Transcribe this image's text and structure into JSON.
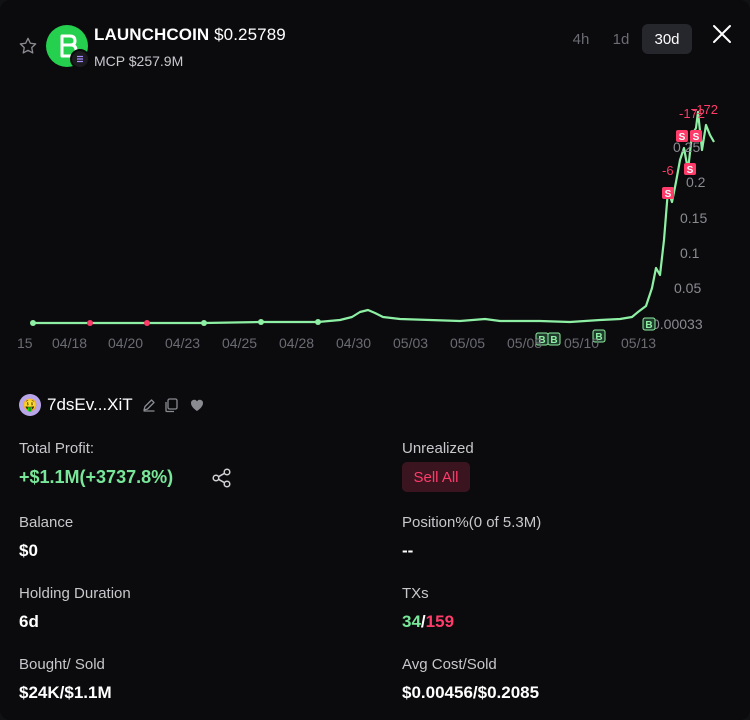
{
  "header": {
    "token_name": "LAUNCHCOIN",
    "price": "$0.25789",
    "mcp": "MCP $257.9M",
    "timeframes": [
      "4h",
      "1d",
      "30d"
    ],
    "active_timeframe": "30d",
    "accent_color": "#25d04f"
  },
  "chart_data": {
    "type": "line",
    "x_labels": [
      "15",
      "04/18",
      "04/20",
      "04/23",
      "04/25",
      "04/28",
      "04/30",
      "05/03",
      "05/05",
      "05/08",
      "05/10",
      "05/13"
    ],
    "y_labels": [
      "0.2",
      "0.15",
      "0.1",
      "0.05",
      "0.00033"
    ],
    "y_partial_labels": [
      "-1",
      "-6",
      "0.2",
      "0.25"
    ],
    "line_color": "#8ef0a4",
    "buy_marker": "B",
    "sell_marker": "S",
    "marker_label_values": [
      "-172",
      "-172",
      "-6"
    ]
  },
  "wallet": {
    "name": "7dsEv...XiT",
    "avatar_emoji": "🤑",
    "icons": [
      "edit-icon",
      "copy-icon",
      "heart-icon"
    ]
  },
  "stats": {
    "total_profit_label": "Total Profit:",
    "total_profit_value": "+$1.1M(+3737.8%)",
    "unrealized_label": "Unrealized",
    "sell_all_label": "Sell All",
    "balance_label": "Balance",
    "balance_value": "$0",
    "position_label": "Position%(0 of 5.3M)",
    "position_value": "--",
    "holding_label": "Holding Duration",
    "holding_value": "6d",
    "txs_label": "TXs",
    "txs_buys": "34",
    "txs_sep": "/",
    "txs_sells": "159",
    "bought_sold_label": "Bought/ Sold",
    "bought_sold_value": "$24K/$1.1M",
    "avg_cost_label": "Avg Cost/Sold",
    "avg_cost_value": "$0.00456/$0.2085"
  }
}
